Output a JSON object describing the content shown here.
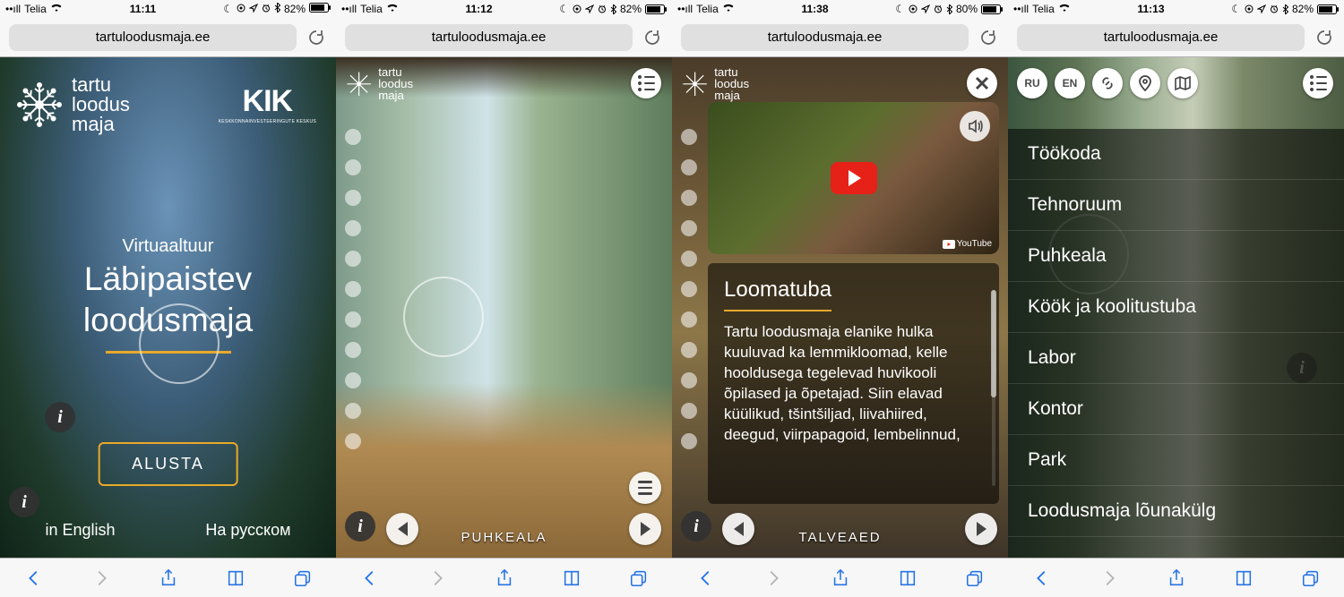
{
  "status": {
    "carrier": "Telia",
    "moon": "☾",
    "icons_right": "⟳ ➶ ⏰ ✽",
    "bt": "82%",
    "bt3": "80%",
    "t1": "11:11",
    "t2": "11:12",
    "t3": "11:38",
    "t4": "11:13"
  },
  "url": "tartuloodusmaja.ee",
  "logo": {
    "l1": "tartu",
    "l2": "loodus",
    "l3": "maja"
  },
  "kik": {
    "big": "KIK",
    "small": "KESKKONNAINVESTEERINGUTE KESKUS"
  },
  "s1": {
    "sub": "Virtuaaltuur",
    "main1": "Läbipaistev",
    "main2": "loodusmaja",
    "start": "ALUSTA",
    "en": "in English",
    "ru": "На русском"
  },
  "s2": {
    "bottom": "PUHKEALA"
  },
  "s3": {
    "yt": "YouTube",
    "title": "Loomatuba",
    "body": "Tartu loodusmaja elanike hulka kuuluvad ka lemmikloomad, kelle hooldusega tegelevad huvikooli õpilased ja õpetajad. Siin elavad küülikud, tšintšiljad, liivahiired, deegud, viirpapagoid, lembelinnud,",
    "bottom": "TALVEAED"
  },
  "s4": {
    "ru": "RU",
    "en": "EN",
    "items": [
      "Töökoda",
      "Tehnoruum",
      "Puhkeala",
      "Köök ja koolitustuba",
      "Labor",
      "Kontor",
      "Park",
      "Loodusmaja lõunakülg"
    ]
  }
}
